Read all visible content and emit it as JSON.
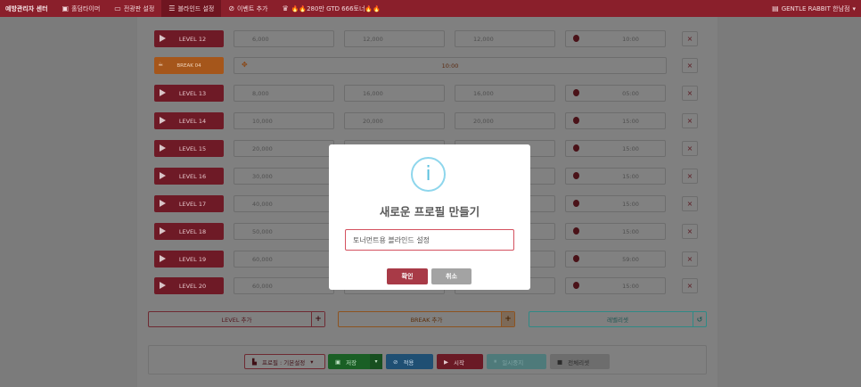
{
  "nav": {
    "brand": "예방관리자 센터",
    "items": [
      {
        "icon": "timer-icon",
        "label": "홀덤타이머"
      },
      {
        "icon": "monitor-icon",
        "label": "전광판 설정"
      },
      {
        "icon": "list-icon",
        "label": "블라인드 설정"
      },
      {
        "icon": "link-icon",
        "label": "이벤트 추가"
      },
      {
        "icon": "trophy-icon",
        "label": "🔥🔥280만 GTD 666토너🔥🔥"
      }
    ],
    "user": "GENTLE RABBIT 한남점"
  },
  "blinds": {
    "rows": [
      {
        "type": "level",
        "label": "LEVEL 12",
        "sb": "6,000",
        "bb": "12,000",
        "ante": "12,000",
        "time": "10:00"
      },
      {
        "type": "break",
        "label": "BREAK 04",
        "time": "10:00"
      },
      {
        "type": "level",
        "label": "LEVEL 13",
        "sb": "8,000",
        "bb": "16,000",
        "ante": "16,000",
        "time": "05:00"
      },
      {
        "type": "level",
        "label": "LEVEL 14",
        "sb": "10,000",
        "bb": "20,000",
        "ante": "20,000",
        "time": "15:00"
      },
      {
        "type": "level",
        "label": "LEVEL 15",
        "sb": "20,000",
        "bb": "",
        "ante": "",
        "time": "15:00"
      },
      {
        "type": "level",
        "label": "LEVEL 16",
        "sb": "30,000",
        "bb": "",
        "ante": "",
        "time": "15:00"
      },
      {
        "type": "level",
        "label": "LEVEL 17",
        "sb": "40,000",
        "bb": "",
        "ante": "",
        "time": "15:00"
      },
      {
        "type": "level",
        "label": "LEVEL 18",
        "sb": "50,000",
        "bb": "",
        "ante": "",
        "time": "15:00"
      },
      {
        "type": "level",
        "label": "LEVEL 19",
        "sb": "60,000",
        "bb": "",
        "ante": "",
        "time": "59:00"
      },
      {
        "type": "level",
        "label": "LEVEL 20",
        "sb": "60,000",
        "bb": "",
        "ante": "",
        "time": "15:00"
      }
    ],
    "delete_symbol": "×"
  },
  "add": {
    "level": "LEVEL 추가",
    "break": "BREAK 추가",
    "reset": "레벨리셋"
  },
  "toolbar": {
    "profile": "프로필 : 기본설정",
    "save": "저장",
    "apply": "적용",
    "start": "시작",
    "pause": "일시중지",
    "reset_all": "전체리셋"
  },
  "modal": {
    "icon": "i",
    "title": "새로운 프로필 만들기",
    "input_value": "토너먼트용 블라인드 설정",
    "ok": "확인",
    "cancel": "취소"
  }
}
